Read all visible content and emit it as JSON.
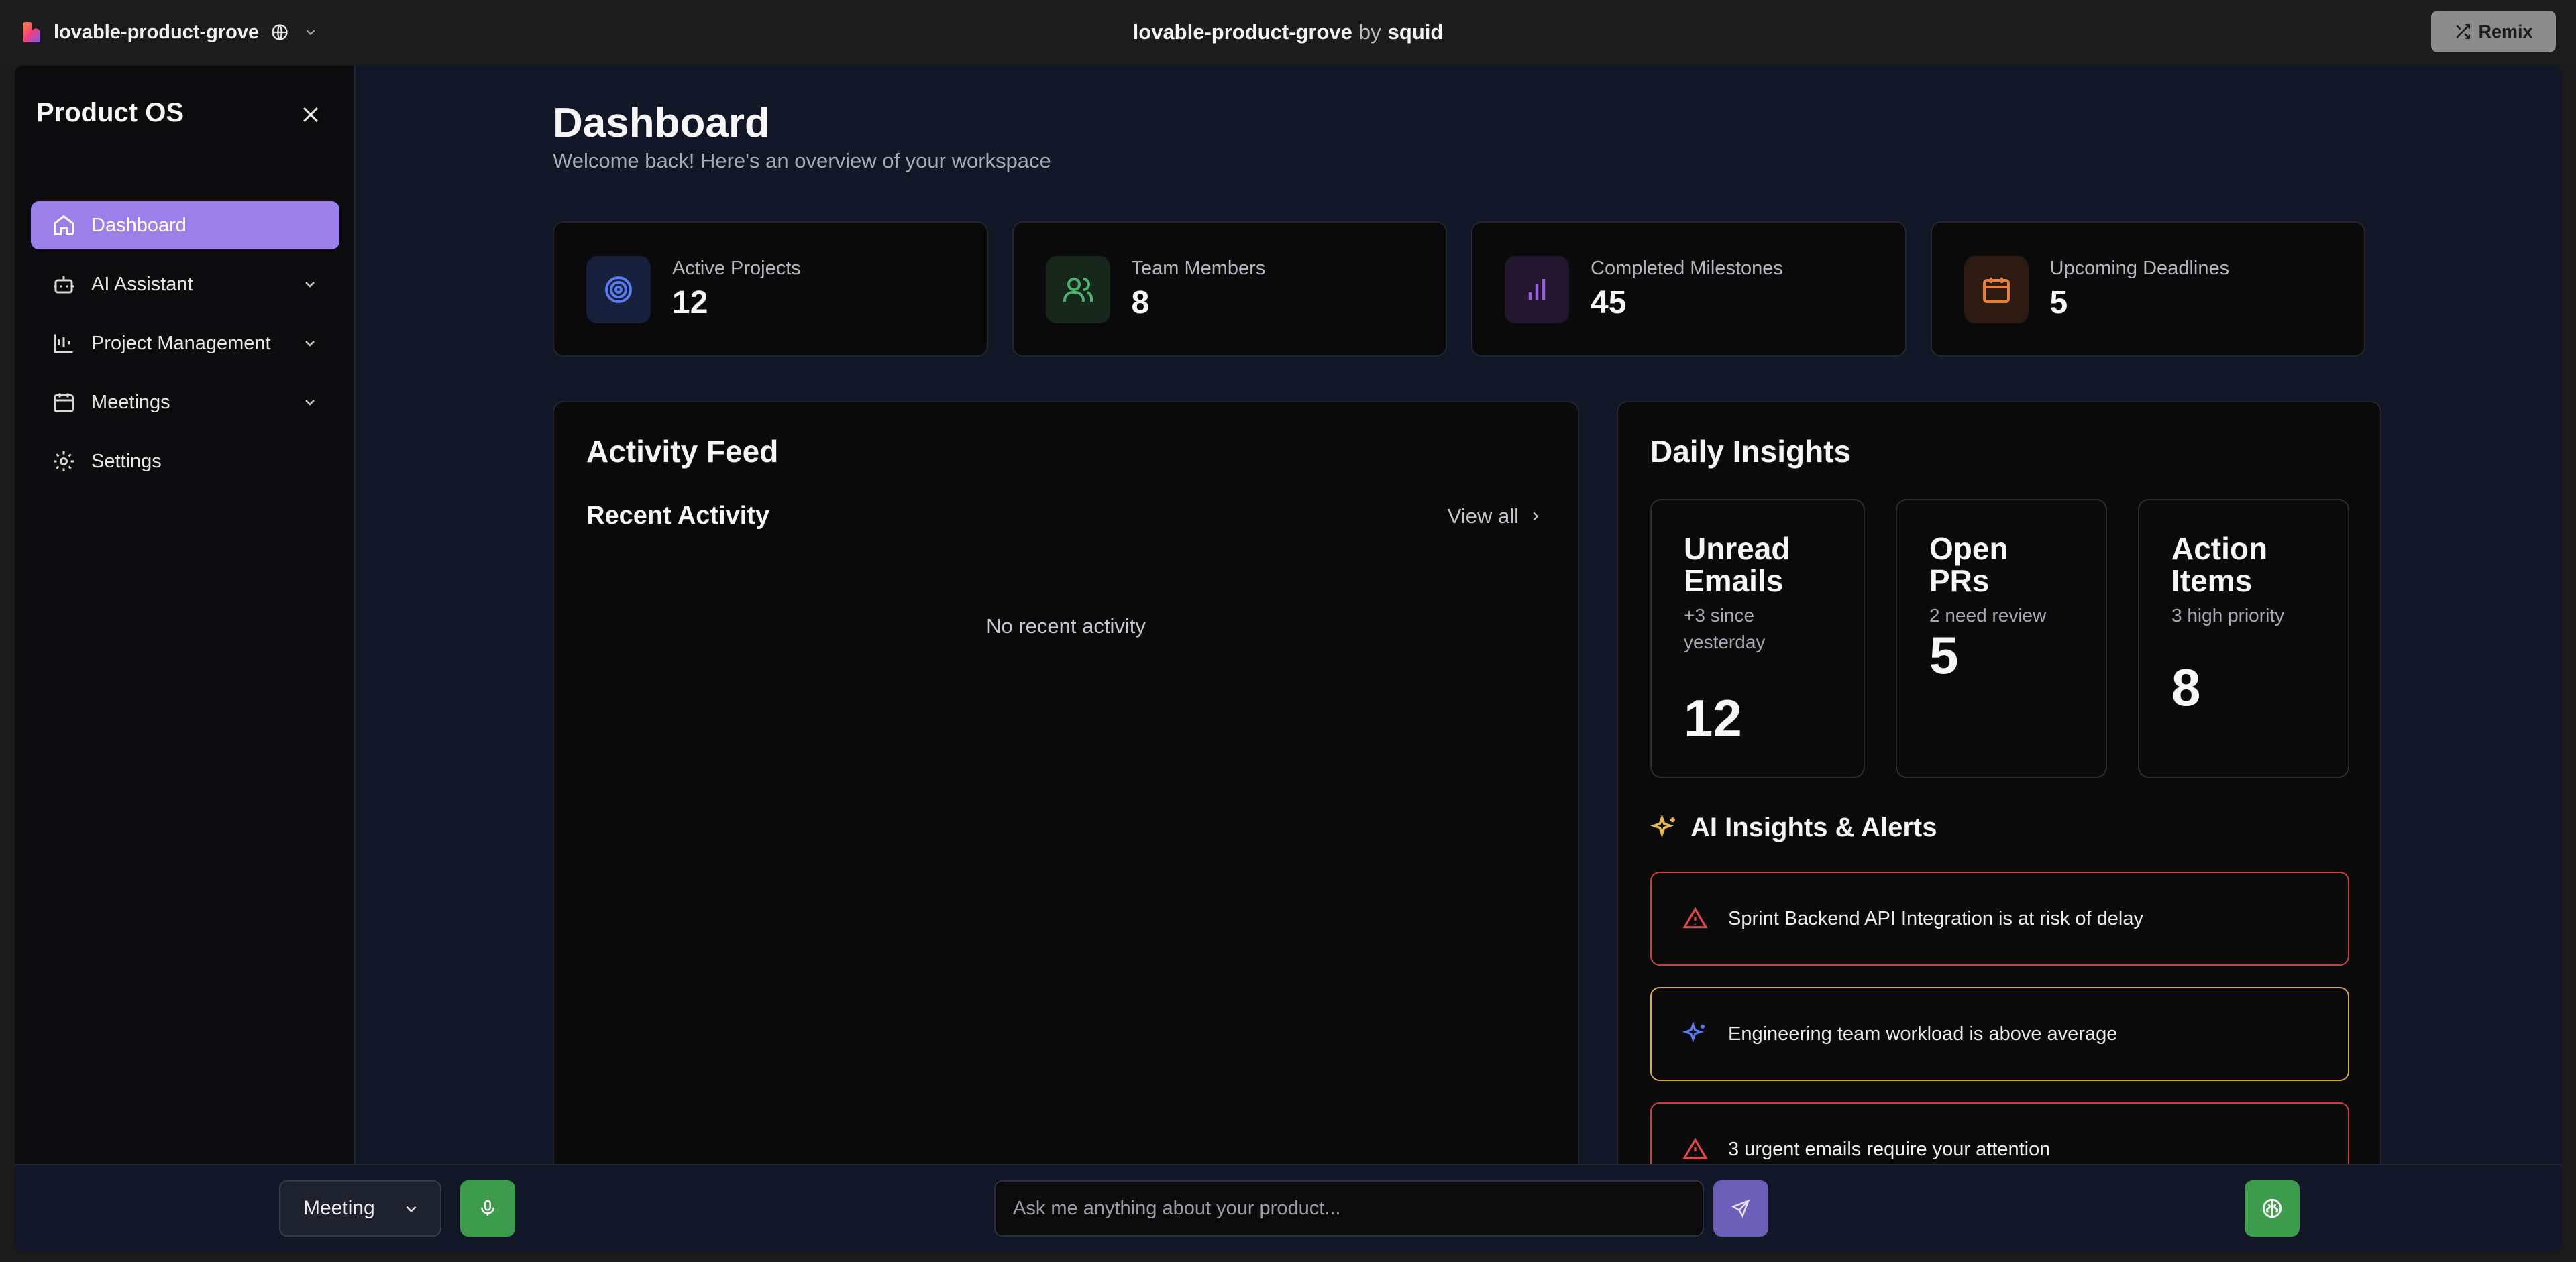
{
  "topbar": {
    "project_name": "lovable-product-grove",
    "center_title": "lovable-product-grove",
    "center_by": "by",
    "center_owner": "squid",
    "remix_label": "Remix"
  },
  "sidebar": {
    "title": "Product OS",
    "items": [
      {
        "label": "Dashboard",
        "icon": "home-icon",
        "active": true
      },
      {
        "label": "AI Assistant",
        "icon": "bot-icon"
      },
      {
        "label": "Project Management",
        "icon": "kanban-icon"
      },
      {
        "label": "Meetings",
        "icon": "calendar-icon"
      },
      {
        "label": "Settings",
        "icon": "gear-icon"
      }
    ]
  },
  "header": {
    "title": "Dashboard",
    "subtitle": "Welcome back! Here's an overview of your workspace"
  },
  "stats": [
    {
      "label": "Active Projects",
      "value": "12",
      "icon": "target-icon",
      "color": "#5b7cf0"
    },
    {
      "label": "Team Members",
      "value": "8",
      "icon": "users-icon",
      "color": "#4caf6a"
    },
    {
      "label": "Completed Milestones",
      "value": "45",
      "icon": "bar-chart-icon",
      "color": "#9a5fe0"
    },
    {
      "label": "Upcoming Deadlines",
      "value": "5",
      "icon": "calendar-icon",
      "color": "#e8803a"
    }
  ],
  "activity": {
    "title": "Activity Feed",
    "subtitle": "Recent Activity",
    "view_all": "View all",
    "empty": "No recent activity"
  },
  "insights": {
    "title": "Daily Insights",
    "cards": [
      {
        "title": "Unread Emails",
        "sub": "+3 since yesterday",
        "value": "12"
      },
      {
        "title": "Open PRs",
        "sub": "2 need review",
        "value": "5"
      },
      {
        "title": "Action Items",
        "sub": "3 high priority",
        "value": "8"
      }
    ],
    "alerts_title": "AI Insights & Alerts",
    "alerts": [
      {
        "text": "Sprint Backend API Integration is at risk of delay",
        "kind": "warning",
        "icon": "alert-triangle-icon"
      },
      {
        "text": "Engineering team workload is above average",
        "kind": "insight",
        "icon": "sparkles-icon"
      },
      {
        "text": "3 urgent emails require your attention",
        "kind": "warning",
        "icon": "alert-triangle-icon"
      }
    ]
  },
  "bottombar": {
    "mode": "Meeting",
    "ask_placeholder": "Ask me anything about your product..."
  },
  "colors": {
    "accent": "#9a80e8",
    "green": "#3d9b4c",
    "send": "#6b5fb8",
    "alert_red": "#c8403e",
    "alert_amber": "#d6a94a"
  }
}
